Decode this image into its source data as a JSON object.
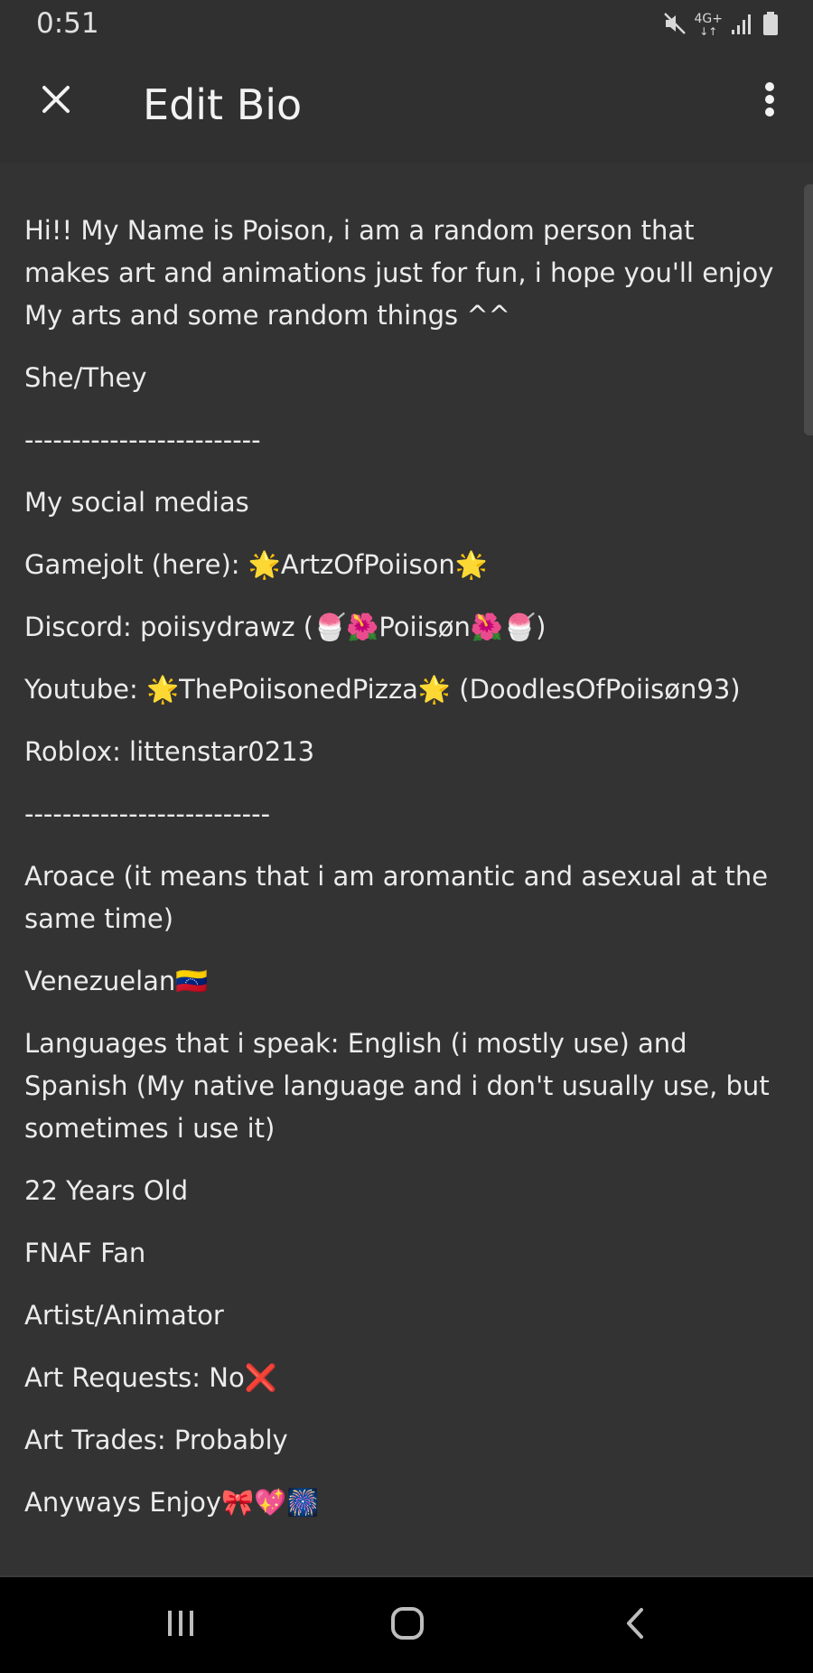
{
  "status_bar": {
    "time": "0:51",
    "network": "4G+"
  },
  "app_bar": {
    "title": "Edit Bio"
  },
  "bio": {
    "paragraphs": [
      "Hi!! My Name is Poison, i am a random person that makes art and animations just for fun, i hope you'll enjoy My arts and some random things ^^",
      "She/They",
      "-------------------------",
      "My social medias",
      "Gamejolt (here): 🌟ArtzOfPoiison🌟",
      "Discord: poiisydrawz (🍧🌺Poiisøn🌺🍧)",
      "Youtube: 🌟ThePoiisonedPizza🌟 (DoodlesOfPoiisøn93)",
      "Roblox: littenstar0213",
      "--------------------------",
      "Aroace (it means that i am aromantic and asexual at the same time)",
      "Venezuelan🇻🇪",
      "Languages that i speak: English (i mostly use) and Spanish (My native language and i don't usually use, but sometimes i use it)",
      "22 Years Old",
      "FNAF Fan",
      "Artist/Animator",
      "Art Requests: No❌",
      "Art Trades: Probably",
      "Anyways Enjoy🎀💖🎆"
    ]
  },
  "colors": {
    "background": "#303030",
    "text": "#ececec",
    "nav_bar": "#000000"
  },
  "icons": {
    "close": "close-icon",
    "menu": "more-vert-icon",
    "nav_recents": "recents-icon",
    "nav_home": "home-icon",
    "nav_back": "back-icon"
  }
}
